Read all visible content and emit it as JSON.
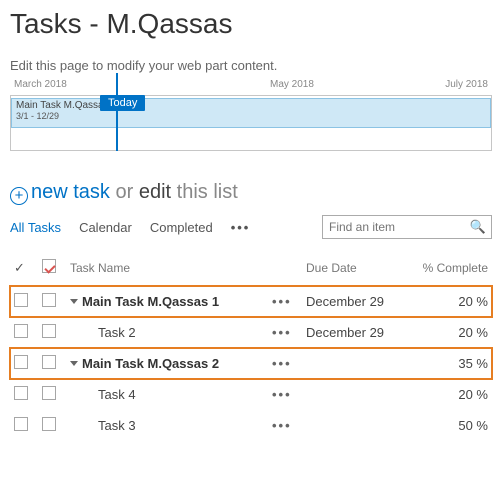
{
  "page": {
    "title": "Tasks - M.Qassas",
    "subtitle": "Edit this page to modify your web part content."
  },
  "timeline": {
    "today_label": "Today",
    "months": {
      "m1": "March 2018",
      "m2": "May 2018",
      "m3": "July 2018"
    },
    "bar": {
      "title": "Main Task M.Qassas 1",
      "range": "3/1 - 12/29"
    }
  },
  "actions": {
    "new_task": "new task",
    "or": " or ",
    "edit": "edit",
    "rest": " this list"
  },
  "views": {
    "all": "All Tasks",
    "calendar": "Calendar",
    "completed": "Completed"
  },
  "search": {
    "placeholder": "Find an item"
  },
  "table": {
    "headers": {
      "task_name": "Task Name",
      "due_date": "Due Date",
      "pct": "% Complete"
    },
    "rows": [
      {
        "name": "Main Task M.Qassas 1",
        "bold": true,
        "caret": true,
        "due": "December 29",
        "pct": "20 %",
        "highlight": true,
        "indent": false
      },
      {
        "name": "Task 2",
        "bold": false,
        "caret": false,
        "due": "December 29",
        "pct": "20 %",
        "highlight": false,
        "indent": true
      },
      {
        "name": "Main Task M.Qassas 2",
        "bold": true,
        "caret": true,
        "due": "",
        "pct": "35 %",
        "highlight": true,
        "indent": false
      },
      {
        "name": "Task 4",
        "bold": false,
        "caret": false,
        "due": "",
        "pct": "20 %",
        "highlight": false,
        "indent": true
      },
      {
        "name": "Task 3",
        "bold": false,
        "caret": false,
        "due": "",
        "pct": "50 %",
        "highlight": false,
        "indent": true
      }
    ]
  }
}
